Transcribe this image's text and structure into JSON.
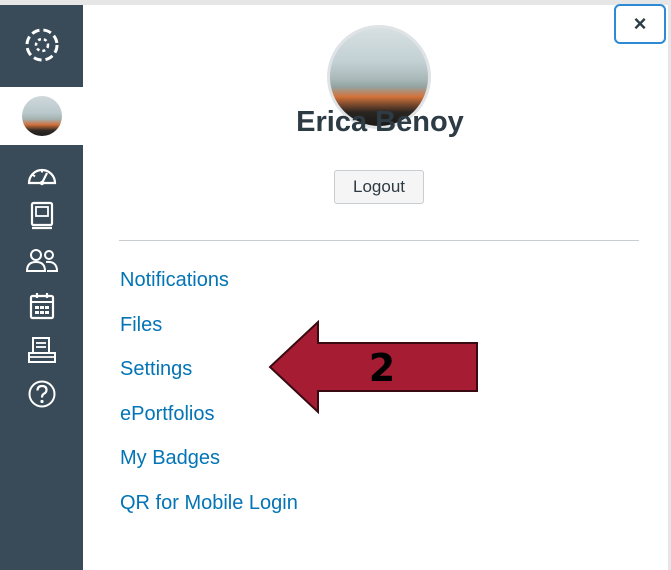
{
  "tray": {
    "close_label": "×",
    "user_name": "Erica Benoy",
    "logout_label": "Logout",
    "links": [
      {
        "label": "Notifications"
      },
      {
        "label": "Files"
      },
      {
        "label": "Settings"
      },
      {
        "label": "ePortfolios"
      },
      {
        "label": "My Badges"
      },
      {
        "label": "QR for Mobile Login"
      }
    ]
  },
  "annotation": {
    "step_number": "2",
    "arrow_color": "#a51c33"
  },
  "sidebar": {
    "background": "#394b58",
    "items": [
      {
        "icon": "canvas-logo-icon"
      },
      {
        "icon": "account-avatar-icon"
      },
      {
        "icon": "dashboard-icon"
      },
      {
        "icon": "courses-icon"
      },
      {
        "icon": "groups-icon"
      },
      {
        "icon": "calendar-icon"
      },
      {
        "icon": "inbox-icon"
      },
      {
        "icon": "help-icon"
      }
    ]
  },
  "colors": {
    "link": "#0374b5",
    "text": "#2d3b45",
    "focus": "#2d8ad6"
  }
}
